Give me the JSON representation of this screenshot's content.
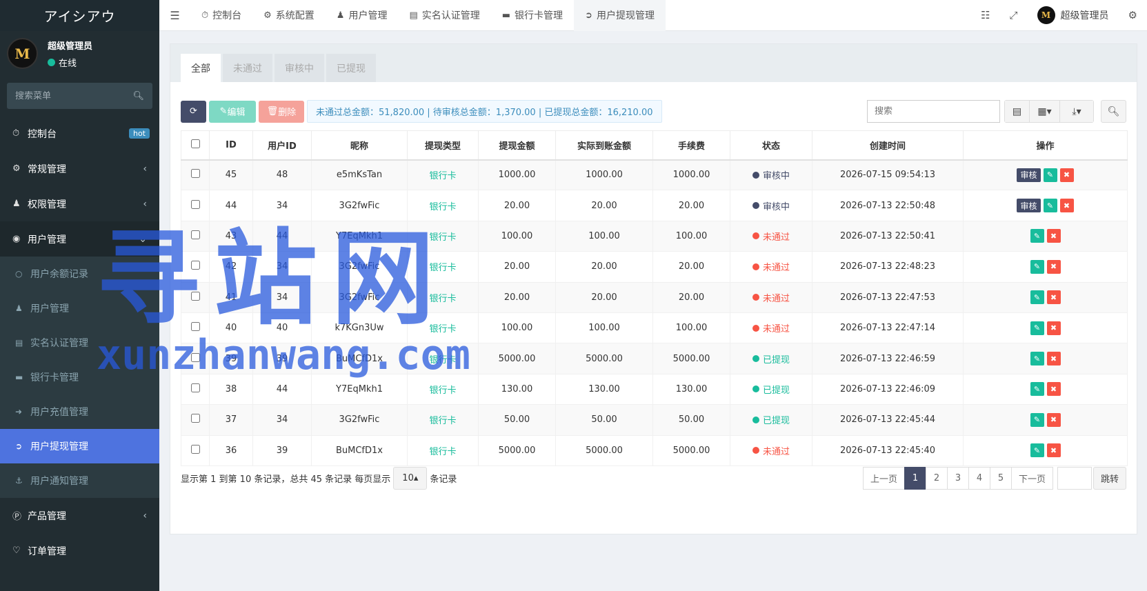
{
  "brand": "アイシアウ",
  "user": {
    "name": "超级管理员",
    "status": "在线",
    "avatar_letter": "M"
  },
  "sidebar": {
    "search_placeholder": "搜索菜单",
    "items": [
      {
        "label": "控制台",
        "badge": "hot"
      },
      {
        "label": "常规管理"
      },
      {
        "label": "权限管理"
      },
      {
        "label": "用户管理"
      }
    ],
    "subitems": [
      {
        "label": "用户余额记录"
      },
      {
        "label": "用户管理"
      },
      {
        "label": "实名认证管理"
      },
      {
        "label": "银行卡管理"
      },
      {
        "label": "用户充值管理"
      },
      {
        "label": "用户提现管理"
      },
      {
        "label": "用户通知管理"
      }
    ],
    "after_items": [
      {
        "label": "产品管理"
      },
      {
        "label": "订单管理"
      }
    ]
  },
  "topbar": {
    "tabs": [
      {
        "label": "控制台"
      },
      {
        "label": "系统配置"
      },
      {
        "label": "用户管理"
      },
      {
        "label": "实名认证管理"
      },
      {
        "label": "银行卡管理"
      },
      {
        "label": "用户提现管理"
      }
    ],
    "user_label": "超级管理员"
  },
  "panel": {
    "tabs": [
      "全部",
      "未通过",
      "审核中",
      "已提现"
    ],
    "btn_edit": "编辑",
    "btn_delete": "删除",
    "summary": "未通过总金额：51,820.00 | 待审核总金额：1,370.00 | 已提现总金额：16,210.00",
    "search_placeholder": "搜索"
  },
  "table": {
    "headers": [
      "ID",
      "用户ID",
      "昵称",
      "提现类型",
      "提现金额",
      "实际到账金额",
      "手续费",
      "状态",
      "创建时间",
      "操作"
    ],
    "audit_label": "审核",
    "rows": [
      {
        "id": "45",
        "uid": "48",
        "nick": "e5mKsTan",
        "type": "银行卡",
        "amount": "1000.00",
        "actual": "1000.00",
        "fee": "1000.00",
        "status": "审核中",
        "state": "pending",
        "time": "2026-07-15 09:54:13"
      },
      {
        "id": "44",
        "uid": "34",
        "nick": "3G2fwFic",
        "type": "银行卡",
        "amount": "20.00",
        "actual": "20.00",
        "fee": "20.00",
        "status": "审核中",
        "state": "pending",
        "time": "2026-07-13 22:50:48"
      },
      {
        "id": "43",
        "uid": "44",
        "nick": "Y7EqMkh1",
        "type": "银行卡",
        "amount": "100.00",
        "actual": "100.00",
        "fee": "100.00",
        "status": "未通过",
        "state": "reject",
        "time": "2026-07-13 22:50:41"
      },
      {
        "id": "42",
        "uid": "34",
        "nick": "3G2fwFic",
        "type": "银行卡",
        "amount": "20.00",
        "actual": "20.00",
        "fee": "20.00",
        "status": "未通过",
        "state": "reject",
        "time": "2026-07-13 22:48:23"
      },
      {
        "id": "41",
        "uid": "34",
        "nick": "3G2fwFic",
        "type": "银行卡",
        "amount": "20.00",
        "actual": "20.00",
        "fee": "20.00",
        "status": "未通过",
        "state": "reject",
        "time": "2026-07-13 22:47:53"
      },
      {
        "id": "40",
        "uid": "40",
        "nick": "k7KGn3Uw",
        "type": "银行卡",
        "amount": "100.00",
        "actual": "100.00",
        "fee": "100.00",
        "status": "未通过",
        "state": "reject",
        "time": "2026-07-13 22:47:14"
      },
      {
        "id": "39",
        "uid": "39",
        "nick": "BuMCfD1x",
        "type": "银行卡",
        "amount": "5000.00",
        "actual": "5000.00",
        "fee": "5000.00",
        "status": "已提现",
        "state": "done",
        "time": "2026-07-13 22:46:59"
      },
      {
        "id": "38",
        "uid": "44",
        "nick": "Y7EqMkh1",
        "type": "银行卡",
        "amount": "130.00",
        "actual": "130.00",
        "fee": "130.00",
        "status": "已提现",
        "state": "done",
        "time": "2026-07-13 22:46:09"
      },
      {
        "id": "37",
        "uid": "34",
        "nick": "3G2fwFic",
        "type": "银行卡",
        "amount": "50.00",
        "actual": "50.00",
        "fee": "50.00",
        "status": "已提现",
        "state": "done",
        "time": "2026-07-13 22:45:44"
      },
      {
        "id": "36",
        "uid": "39",
        "nick": "BuMCfD1x",
        "type": "银行卡",
        "amount": "5000.00",
        "actual": "5000.00",
        "fee": "5000.00",
        "status": "未通过",
        "state": "reject",
        "time": "2026-07-13 22:45:40"
      }
    ]
  },
  "footer": {
    "info_prefix": "显示第 1 到第 10 条记录，总共 45 条记录 每页显示",
    "page_size": "10",
    "info_suffix": "条记录",
    "prev": "上一页",
    "pages": [
      "1",
      "2",
      "3",
      "4",
      "5"
    ],
    "next": "下一页",
    "jump": "跳转"
  },
  "watermark": {
    "cn": "寻站网",
    "en": "xunzhanwang.com"
  },
  "colors": {
    "accent": "#444c69",
    "success": "#18bc9c",
    "danger": "#f75444",
    "sidebar_active": "#4e73df"
  }
}
